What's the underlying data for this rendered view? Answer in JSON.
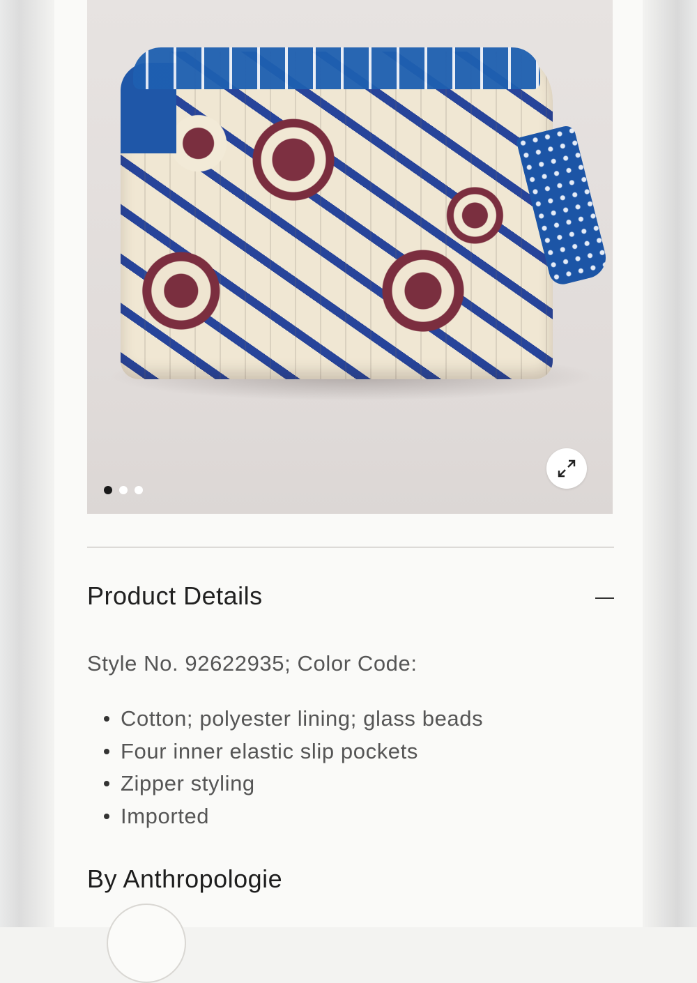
{
  "product": {
    "image_alt": "Quilted floral pouch",
    "carousel": {
      "total": 3,
      "active_index": 0
    },
    "expand_icon": "expand-arrows-icon"
  },
  "details": {
    "title": "Product Details",
    "toggle_icon": "minus-icon",
    "style_line": "Style No. 92622935; Color Code:",
    "bullets": [
      "Cotton; polyester lining; glass beads",
      "Four inner elastic slip pockets",
      "Zipper styling",
      "Imported"
    ]
  },
  "brand": {
    "heading": "By Anthropologie"
  },
  "colors": {
    "page_bg": "#fafaf8",
    "text_primary": "#202020",
    "text_secondary": "#555555"
  }
}
